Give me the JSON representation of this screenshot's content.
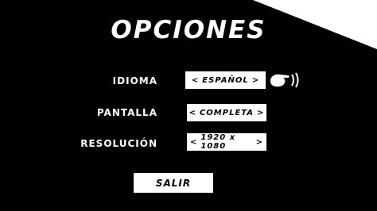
{
  "menu": {
    "title": "OPCIONES",
    "rows": [
      {
        "label": "IDIOMA",
        "value": "ESPAÑOL",
        "left_arrow": "<",
        "right_arrow": ">"
      },
      {
        "label": "PANTALLA",
        "value": "COMPLETA",
        "left_arrow": "<",
        "right_arrow": ">"
      },
      {
        "label": "RESOLUCIÓN",
        "value": "1920 x 1080",
        "left_arrow": "<",
        "right_arrow": ">"
      }
    ],
    "exit_label": "SALIR"
  },
  "colors": {
    "background": "#000000",
    "foreground": "#ffffff"
  },
  "icons": {
    "cursor": "pointing-hand-icon"
  }
}
